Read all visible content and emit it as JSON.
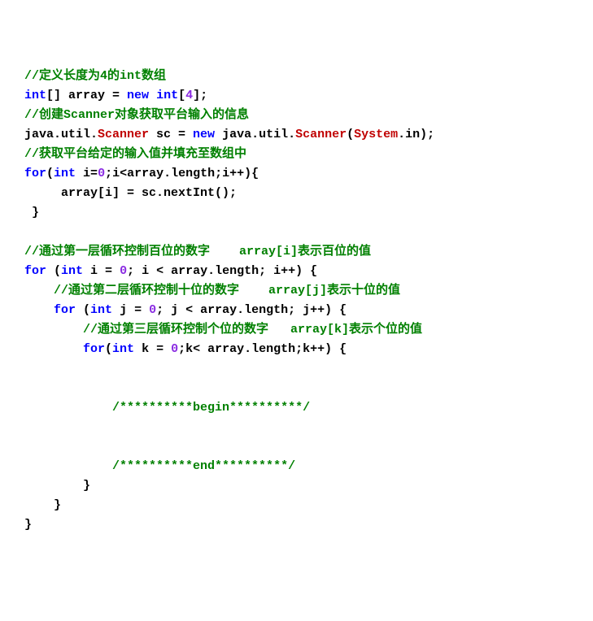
{
  "lines": [
    [
      [
        "cmt",
        "//定义长度为4的int数组"
      ]
    ],
    [
      [
        "kw",
        "int"
      ],
      [
        "txt",
        "[] array = "
      ],
      [
        "kw",
        "new"
      ],
      [
        "txt",
        " "
      ],
      [
        "kw",
        "int"
      ],
      [
        "txt",
        "["
      ],
      [
        "num",
        "4"
      ],
      [
        "txt",
        "];"
      ]
    ],
    [
      [
        "cmt",
        "//创建Scanner对象获取平台输入的信息"
      ]
    ],
    [
      [
        "txt",
        "java.util."
      ],
      [
        "cls",
        "Scanner"
      ],
      [
        "txt",
        " sc = "
      ],
      [
        "kw",
        "new"
      ],
      [
        "txt",
        " java.util."
      ],
      [
        "cls",
        "Scanner"
      ],
      [
        "txt",
        "("
      ],
      [
        "cls",
        "System"
      ],
      [
        "txt",
        ".in);"
      ]
    ],
    [
      [
        "cmt",
        "//获取平台给定的输入值并填充至数组中"
      ]
    ],
    [
      [
        "kw",
        "for"
      ],
      [
        "txt",
        "("
      ],
      [
        "kw",
        "int"
      ],
      [
        "txt",
        " i="
      ],
      [
        "num",
        "0"
      ],
      [
        "txt",
        ";i<array.length;i++){"
      ]
    ],
    [
      [
        "txt",
        "     array[i] = sc.nextInt();"
      ]
    ],
    [
      [
        "txt",
        " }"
      ]
    ],
    [
      [
        "txt",
        ""
      ]
    ],
    [
      [
        "cmt",
        "//通过第一层循环控制百位的数字    array[i]表示百位的值"
      ]
    ],
    [
      [
        "kw",
        "for"
      ],
      [
        "txt",
        " ("
      ],
      [
        "kw",
        "int"
      ],
      [
        "txt",
        " i = "
      ],
      [
        "num",
        "0"
      ],
      [
        "txt",
        "; i < array.length; i++) {"
      ]
    ],
    [
      [
        "txt",
        "    "
      ],
      [
        "cmt",
        "//通过第二层循环控制十位的数字    array[j]表示十位的值"
      ]
    ],
    [
      [
        "txt",
        "    "
      ],
      [
        "kw",
        "for"
      ],
      [
        "txt",
        " ("
      ],
      [
        "kw",
        "int"
      ],
      [
        "txt",
        " j = "
      ],
      [
        "num",
        "0"
      ],
      [
        "txt",
        "; j < array.length; j++) {"
      ]
    ],
    [
      [
        "txt",
        "        "
      ],
      [
        "cmt",
        "//通过第三层循环控制个位的数字   array[k]表示个位的值"
      ]
    ],
    [
      [
        "txt",
        "        "
      ],
      [
        "kw",
        "for"
      ],
      [
        "txt",
        "("
      ],
      [
        "kw",
        "int"
      ],
      [
        "txt",
        " k = "
      ],
      [
        "num",
        "0"
      ],
      [
        "txt",
        ";k< array.length;k++) {"
      ]
    ],
    [
      [
        "txt",
        ""
      ]
    ],
    [
      [
        "txt",
        ""
      ]
    ],
    [
      [
        "txt",
        "            "
      ],
      [
        "cmt",
        "/**********begin**********/"
      ]
    ],
    [
      [
        "txt",
        ""
      ]
    ],
    [
      [
        "txt",
        ""
      ]
    ],
    [
      [
        "txt",
        "            "
      ],
      [
        "cmt",
        "/**********end**********/"
      ]
    ],
    [
      [
        "txt",
        "        }"
      ]
    ],
    [
      [
        "txt",
        "    }"
      ]
    ],
    [
      [
        "txt",
        "}"
      ]
    ]
  ]
}
